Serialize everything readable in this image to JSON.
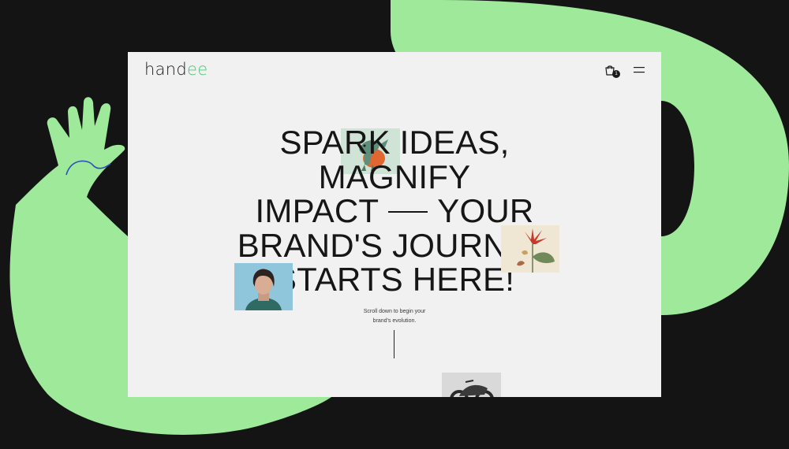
{
  "brand": {
    "logo_prefix": "hand",
    "logo_accent": "ee"
  },
  "header": {
    "cart_icon": "shopping-bag-icon",
    "cart_count": "1",
    "menu_icon": "hamburger-menu-icon"
  },
  "hero": {
    "line1": "SPARK IDEAS,",
    "line2": "MAGNIFY",
    "line3_part1": "IMPACT",
    "line3_part2": "YOUR",
    "line4": "BRAND'S JOURNEY",
    "line5": "STARTS HERE!",
    "caption_line1": "Scroll down to begin your",
    "caption_line2": "brand's evolution."
  },
  "colors": {
    "page_background": "#141414",
    "decor_green": "#9ee99a",
    "site_background": "#f1f1f1",
    "text": "#161616",
    "logo_accent": "#55c47a",
    "wave_line": "#2f4fbf"
  }
}
